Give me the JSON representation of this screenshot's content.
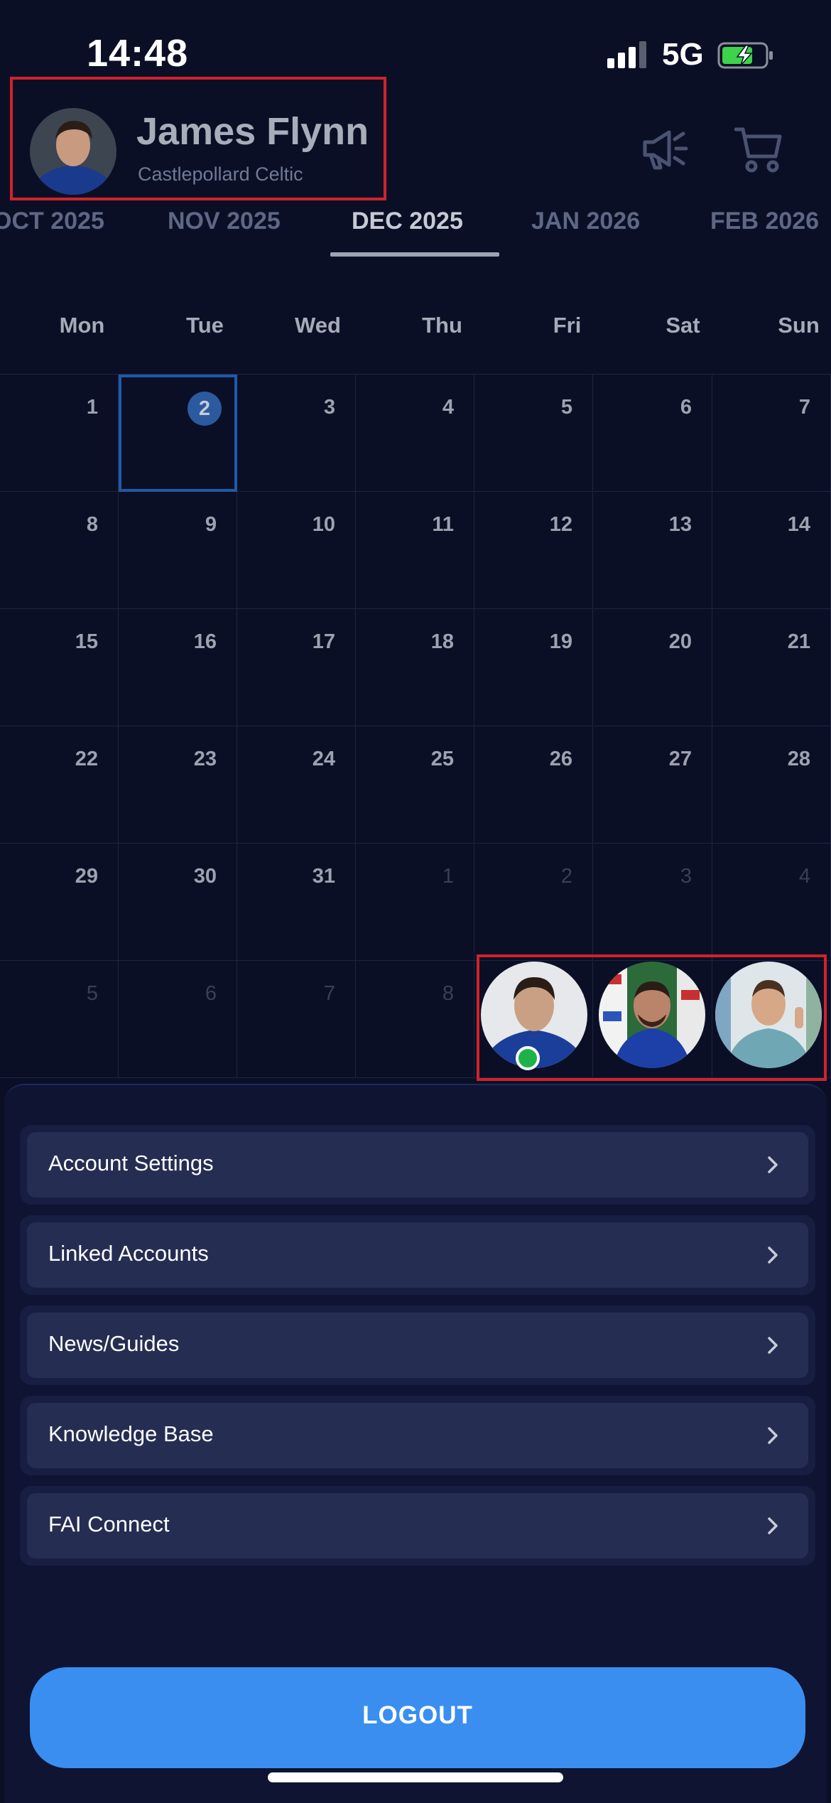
{
  "status_bar": {
    "time": "14:48",
    "network": "5G"
  },
  "profile": {
    "name": "James Flynn",
    "club": "Castlepollard Celtic"
  },
  "header_icons": [
    "megaphone-icon",
    "cart-icon"
  ],
  "months": [
    "OCT 2025",
    "NOV 2025",
    "DEC 2025",
    "JAN 2026",
    "FEB 2026"
  ],
  "active_month": "DEC 2025",
  "weekdays": [
    "Mon",
    "Tue",
    "Wed",
    "Thu",
    "Fri",
    "Sat",
    "Sun"
  ],
  "calendar_days": [
    [
      "1",
      "2",
      "3",
      "4",
      "5",
      "6",
      "7"
    ],
    [
      "8",
      "9",
      "10",
      "11",
      "12",
      "13",
      "14"
    ],
    [
      "15",
      "16",
      "17",
      "18",
      "19",
      "20",
      "21"
    ],
    [
      "22",
      "23",
      "24",
      "25",
      "26",
      "27",
      "28"
    ],
    [
      "29",
      "30",
      "31",
      "1",
      "2",
      "3",
      "4"
    ],
    [
      "5",
      "6",
      "7",
      "8",
      "",
      "",
      ""
    ]
  ],
  "today": "2",
  "linked_profiles": [
    "player-avatar",
    "coach-avatar",
    "parent-avatar"
  ],
  "menu": [
    {
      "label": "Account Settings"
    },
    {
      "label": "Linked Accounts"
    },
    {
      "label": "News/Guides"
    },
    {
      "label": "Knowledge Base"
    },
    {
      "label": "FAI Connect"
    }
  ],
  "logout_label": "LOGOUT",
  "colors": {
    "background": "#0b0f26",
    "accent": "#3a8ef0",
    "today": "#2c5a9e",
    "highlight": "#d1222c",
    "online": "#1fb24a"
  }
}
